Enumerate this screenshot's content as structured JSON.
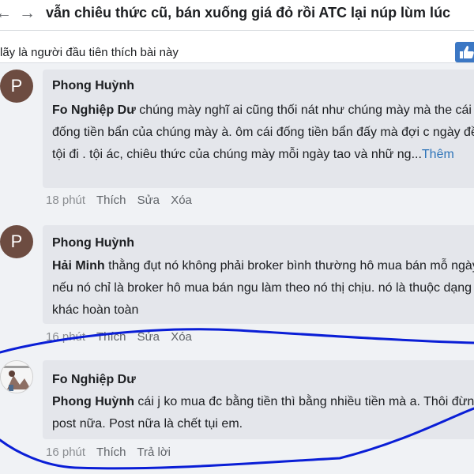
{
  "header": {
    "back_icon": "arrow-left-icon",
    "forward_icon": "arrow-right-icon",
    "title": "vẫn chiêu thức cũ, bán xuống giá đỏ rồi ATC lại núp lùm lúc"
  },
  "likes": {
    "text": "lãy là người đầu tiên thích bài này",
    "button_icon": "thumbs-up-icon"
  },
  "comments": [
    {
      "avatar_letter": "P",
      "author": "Phong Huỳnh",
      "mention": "Fo Nghiệp Dư",
      "text": " chúng mày nghĩ ai cũng thối nát như chúng mày mà the cái đống tiền bẩn của chúng mày à. ôm cái đống tiền bẩn đấy mà đợi c ngày đền tội đi . tội ác, chiêu thức của chúng mày mỗi ngày tao và nhữ ng...",
      "more": "Thêm",
      "time": "18 phút",
      "actions": [
        "Thích",
        "Sửa",
        "Xóa"
      ]
    },
    {
      "avatar_letter": "P",
      "author": "Phong Huỳnh",
      "mention": "Hải Minh",
      "text": " thằng đụt nó không phải broker bình thường hô mua bán mỗ ngày . nếu nó chỉ là broker hô mua bán ngu làm theo nó thị chịu. nó là thuộc dạng khác hoàn toàn",
      "time": "16 phút",
      "actions": [
        "Thích",
        "Sửa",
        "Xóa"
      ]
    },
    {
      "author": "Fo Nghiệp Dư",
      "mention": "Phong Huỳnh",
      "text": " cái j ko mua đc bằng tiền thì bằng nhiều tiền mà a. Thôi đừng post nữa. Post nữa là chết tụi em.",
      "time": "16 phút",
      "actions": [
        "Thích",
        "Trả lời"
      ]
    }
  ],
  "colors": {
    "link": "#2d73b8",
    "bubble": "#e4e6eb",
    "avatar": "#6d4c41",
    "annotation": "#0a1ed6"
  }
}
